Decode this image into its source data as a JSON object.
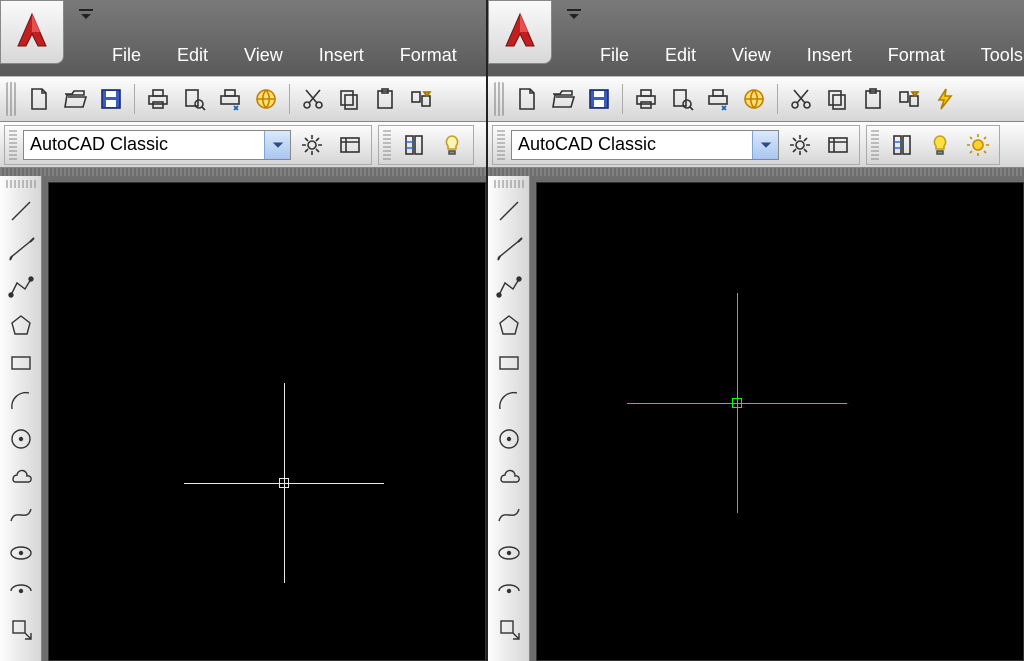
{
  "menus": {
    "file": "File",
    "edit": "Edit",
    "view": "View",
    "insert": "Insert",
    "format": "Format",
    "tools_trunc_left": "To",
    "tools": "Tools"
  },
  "workspace": {
    "label": "AutoCAD Classic"
  },
  "crosshair": {
    "left_color": "#e8e8e8",
    "right_color": "#00ff00"
  },
  "icons": {
    "logo": "autocad-logo",
    "new": "new",
    "open": "open",
    "save": "save",
    "print": "print",
    "preview": "print-preview",
    "publish": "publish",
    "globe": "3d-globe",
    "cut": "cut",
    "copy": "copy",
    "paste": "paste",
    "match": "match-props",
    "bolt": "action-macro",
    "gear": "settings",
    "wsicon": "workspace-icon",
    "toolpal": "tool-palette",
    "bulb_off": "lightbulb-off",
    "bulb_on": "lightbulb-on",
    "sun": "sun",
    "line": "line",
    "cline": "construction-line",
    "pline": "polyline",
    "polygon": "polygon",
    "rect": "rectangle",
    "arc": "arc",
    "circle": "circle",
    "revcloud": "revision-cloud",
    "spline": "spline",
    "ellipse": "ellipse",
    "earc": "ellipse-arc",
    "insertblk": "insert-block"
  }
}
